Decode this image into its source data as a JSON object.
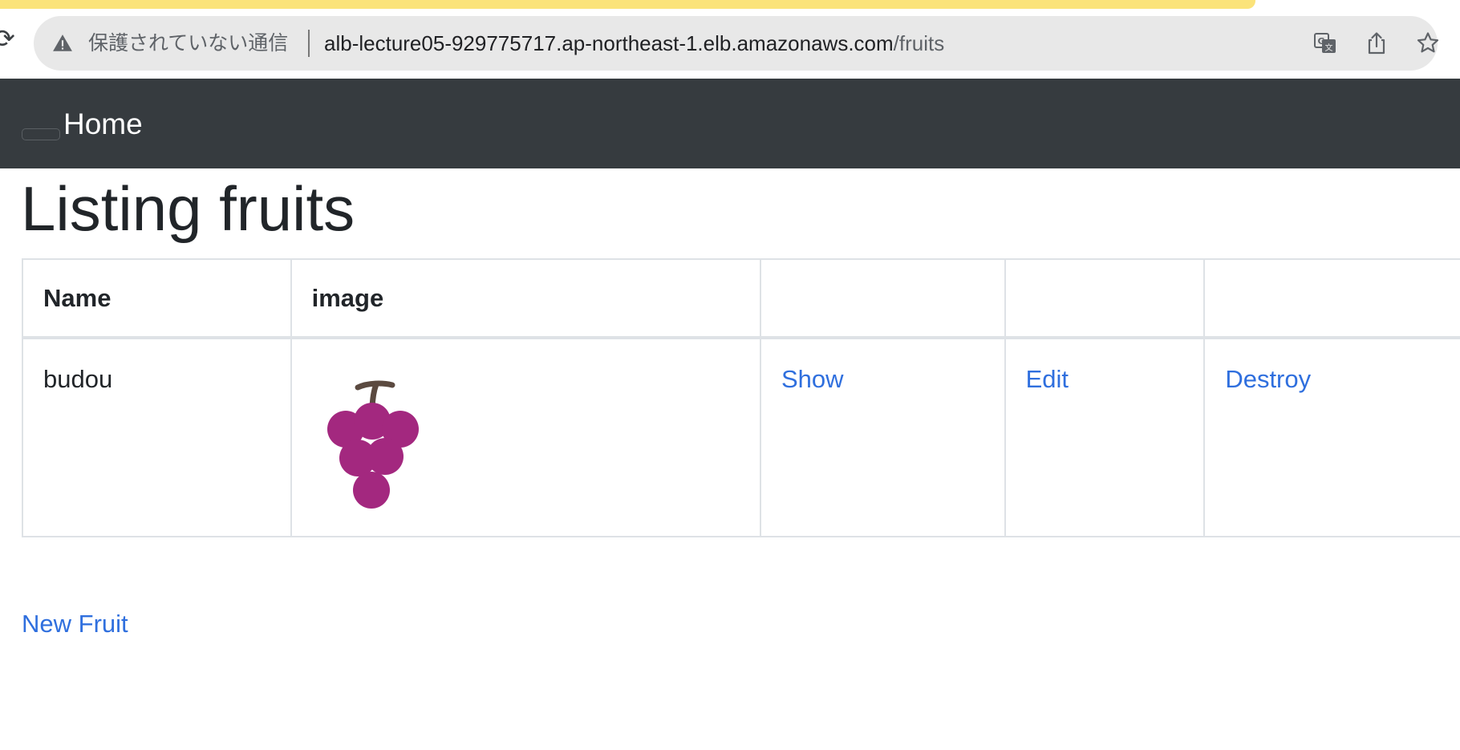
{
  "browser": {
    "security_label": "保護されていない通信",
    "url_host": "alb-lecture05-929775717.ap-northeast-1.elb.amazonaws.com",
    "url_path": "/fruits",
    "accent_color": "#fbe37a"
  },
  "navbar": {
    "brand": "Home",
    "background": "#363b3f"
  },
  "page": {
    "title": "Listing fruits"
  },
  "table": {
    "headers": [
      "Name",
      "image",
      "",
      "",
      ""
    ],
    "rows": [
      {
        "name": "budou",
        "image_icon": "grape-icon",
        "show_label": "Show",
        "edit_label": "Edit",
        "destroy_label": "Destroy"
      }
    ]
  },
  "actions": {
    "new_fruit_label": "New Fruit"
  },
  "colors": {
    "link": "#2f6fde",
    "text": "#212529",
    "grape": "#a3287f"
  }
}
